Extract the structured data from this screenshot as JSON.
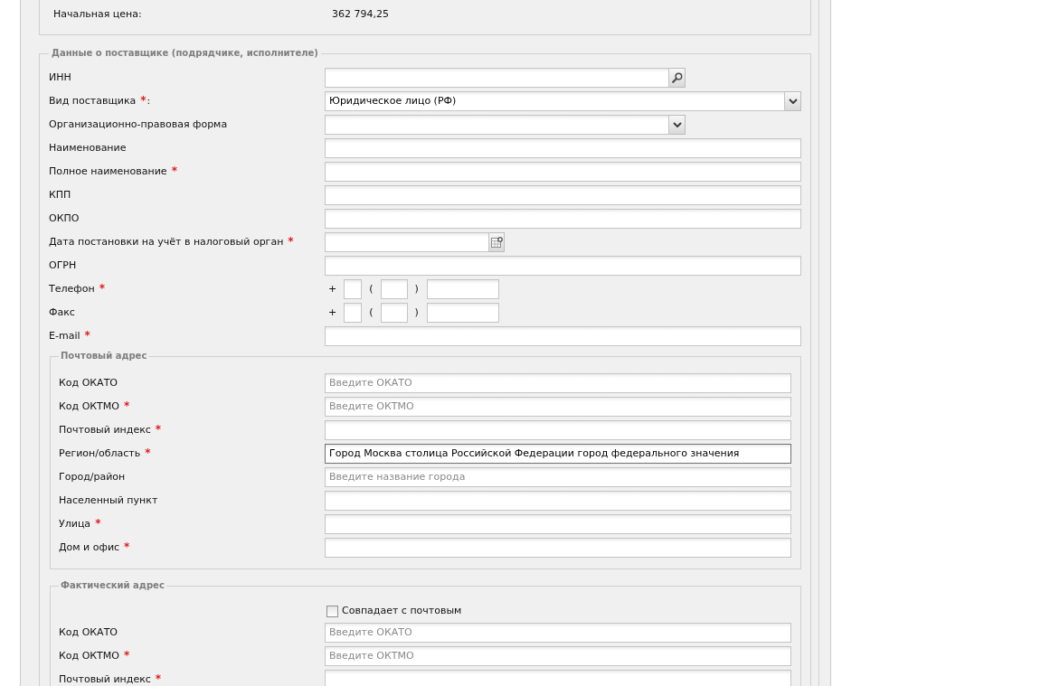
{
  "notice": {
    "rows": [
      {
        "label": "Начальная цена:",
        "value": "362 794,25"
      }
    ]
  },
  "supplier": {
    "title": "Данные о поставщике (подрядчике, исполнителе)",
    "fields": [
      {
        "kind": "search",
        "label": "ИНН",
        "focused": false
      },
      {
        "kind": "select",
        "label": "Вид поставщика",
        "required_mark": "*",
        "label_suffix": ":",
        "value": "Юридическое лицо (РФ)",
        "focused": false
      },
      {
        "kind": "select",
        "label": "Организационно-правовая форма",
        "focused": false
      },
      {
        "kind": "text",
        "label": "Наименование",
        "focused": false
      },
      {
        "kind": "text",
        "label": "Полное наименование",
        "required_mark": "*",
        "focused": false
      },
      {
        "kind": "text",
        "label": "КПП",
        "focused": false
      },
      {
        "kind": "text",
        "label": "ОКПО",
        "focused": false
      },
      {
        "kind": "date",
        "label": "Дата постановки на учёт в налоговый орган",
        "required_mark": "*",
        "focused": false
      },
      {
        "kind": "text",
        "label": "ОГРН",
        "focused": false
      },
      {
        "kind": "phone",
        "label": "Телефон",
        "required_mark": "*",
        "prefix": "+",
        "open": "(",
        "close": ")",
        "focused": false
      },
      {
        "kind": "phone",
        "label": "Факс",
        "prefix": "+",
        "open": "(",
        "close": ")",
        "focused": false
      },
      {
        "kind": "text",
        "label": "E-mail",
        "required_mark": "*",
        "focused": false
      }
    ],
    "postal_address": {
      "title": "Почтовый адрес",
      "fields": [
        {
          "kind": "text",
          "label": "Код ОКАТО",
          "placeholder": "Введите ОКАТО",
          "focused": false
        },
        {
          "kind": "text",
          "label": "Код ОКТМО",
          "required_mark": "*",
          "placeholder": "Введите ОКТМО",
          "focused": false
        },
        {
          "kind": "text",
          "label": "Почтовый индекс",
          "required_mark": "*",
          "focused": false
        },
        {
          "kind": "text",
          "label": "Регион/область",
          "required_mark": "*",
          "value": "Город Москва столица Российской Федерации город федерального значения",
          "focused": true
        },
        {
          "kind": "text",
          "label": "Город/район",
          "placeholder": "Введите название города",
          "focused": false
        },
        {
          "kind": "text",
          "label": "Населенный пункт",
          "focused": false
        },
        {
          "kind": "text",
          "label": "Улица",
          "required_mark": "*",
          "focused": false
        },
        {
          "kind": "text",
          "label": "Дом и офис",
          "required_mark": "*",
          "focused": false
        }
      ]
    },
    "actual_address": {
      "title": "Фактический адрес",
      "fields": [
        {
          "kind": "checkbox",
          "label": "Совпадает с почтовым",
          "checked": false
        },
        {
          "kind": "text",
          "label": "Код ОКАТО",
          "placeholder": "Введите ОКАТО",
          "focused": false
        },
        {
          "kind": "text",
          "label": "Код ОКТМО",
          "required_mark": "*",
          "placeholder": "Введите ОКТМО",
          "focused": false
        },
        {
          "kind": "text",
          "label": "Почтовый индекс",
          "required_mark": "*",
          "focused": false
        }
      ]
    }
  }
}
